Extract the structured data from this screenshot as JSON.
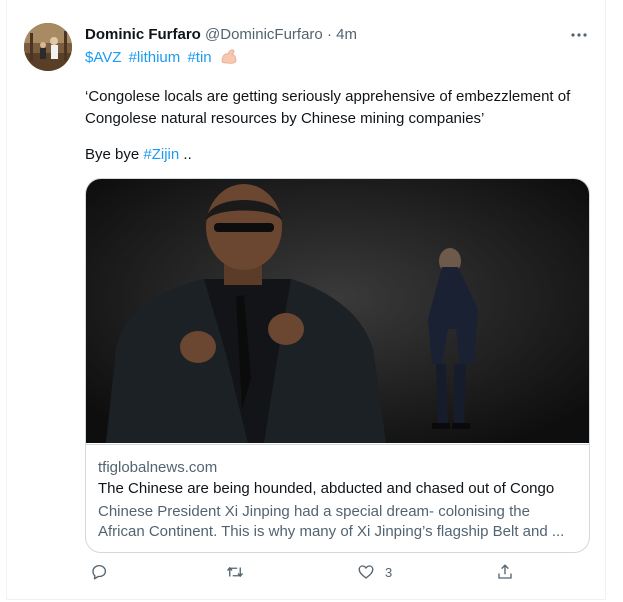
{
  "tweet": {
    "author_name": "Dominic Furfaro",
    "author_handle": "@DominicFurfaro",
    "separator": "·",
    "time": "4m",
    "cashtag": "$AVZ",
    "hashtags": [
      "#lithium",
      "#tin"
    ],
    "emoji_icon": "flexed-biceps-icon",
    "quote_text": "‘Congolese locals are getting seriously apprehensive of embezzlement of Congolese natural resources by Chinese mining companies’",
    "bye_prefix": "Bye bye ",
    "bye_hashtag": "#Zijin",
    "bye_suffix": " .."
  },
  "card": {
    "domain": "tfiglobalnews.com",
    "title": "The Chinese are being hounded, abducted and chased out of Congo",
    "description_line1": "Chinese President Xi Jinping had a special dream- colonising the",
    "description_line2": "African Continent. This is why many of Xi Jinping’s flagship Belt and ..."
  },
  "actions": {
    "reply_icon": "reply-icon",
    "retweet_icon": "retweet-icon",
    "like_icon": "heart-icon",
    "like_count": "3",
    "share_icon": "share-icon"
  },
  "colors": {
    "accent": "#1d9bf0",
    "secondary_text": "#536471",
    "border": "#cfd9de"
  }
}
